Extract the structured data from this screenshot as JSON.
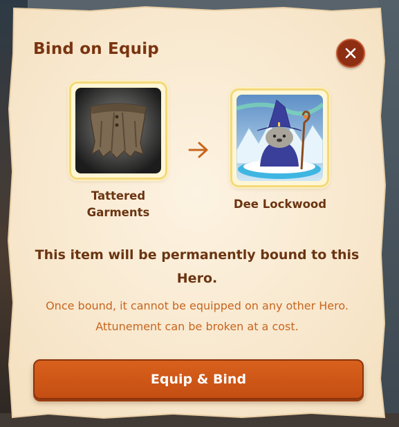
{
  "dialog": {
    "title": "Bind on Equip",
    "close_icon": "close-icon",
    "item": {
      "name": "Tattered Garments",
      "icon": "tattered-garments-image"
    },
    "arrow_icon": "arrow-right-icon",
    "hero": {
      "name": "Dee Lockwood",
      "icon": "hero-portrait-image"
    },
    "headline": "This item will be permanently bound to this Hero.",
    "description": "Once bound, it cannot be equipped on any other Hero. Attunement can be broken at a cost.",
    "primary_button": "Equip & Bind"
  },
  "colors": {
    "title": "#7a3410",
    "accent": "#c8651f",
    "button": "#d25a18",
    "close_button": "#8e2e12",
    "card_border": "#f4d97a"
  }
}
